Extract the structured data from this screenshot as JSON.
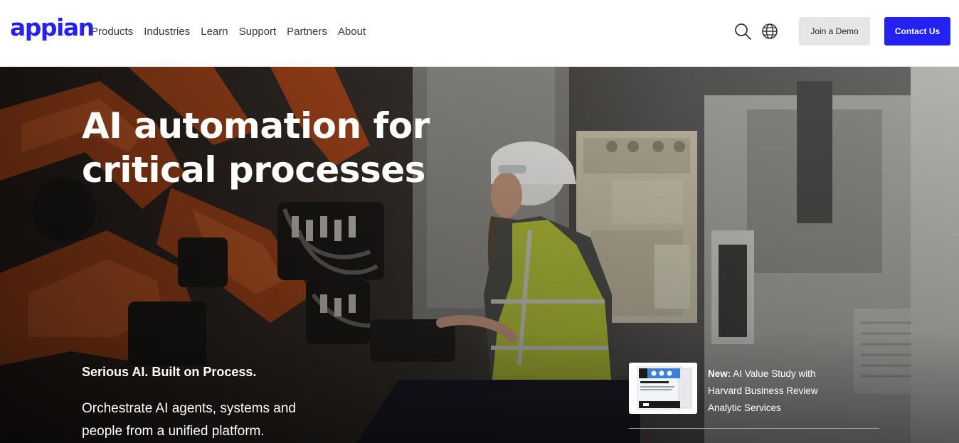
{
  "brand": {
    "logo_text": "appian",
    "color": "#2322f0"
  },
  "nav": {
    "items": [
      "Products",
      "Industries",
      "Learn",
      "Support",
      "Partners",
      "About"
    ]
  },
  "header_icons": {
    "search": "search-icon",
    "language": "globe-icon"
  },
  "buttons": {
    "demo_label": "Join a Demo",
    "contact_label": "Contact Us"
  },
  "hero": {
    "title_line1": "AI automation for",
    "title_line2": "critical processes",
    "tagline": "Serious AI. Built on Process.",
    "description": "Orchestrate AI agents, systems and people from a unified platform."
  },
  "promo": {
    "prefix": "New:",
    "text": "AI Value Study with Harvard Business Review Analytic Services",
    "thumb_title": "When Does AI Make"
  }
}
